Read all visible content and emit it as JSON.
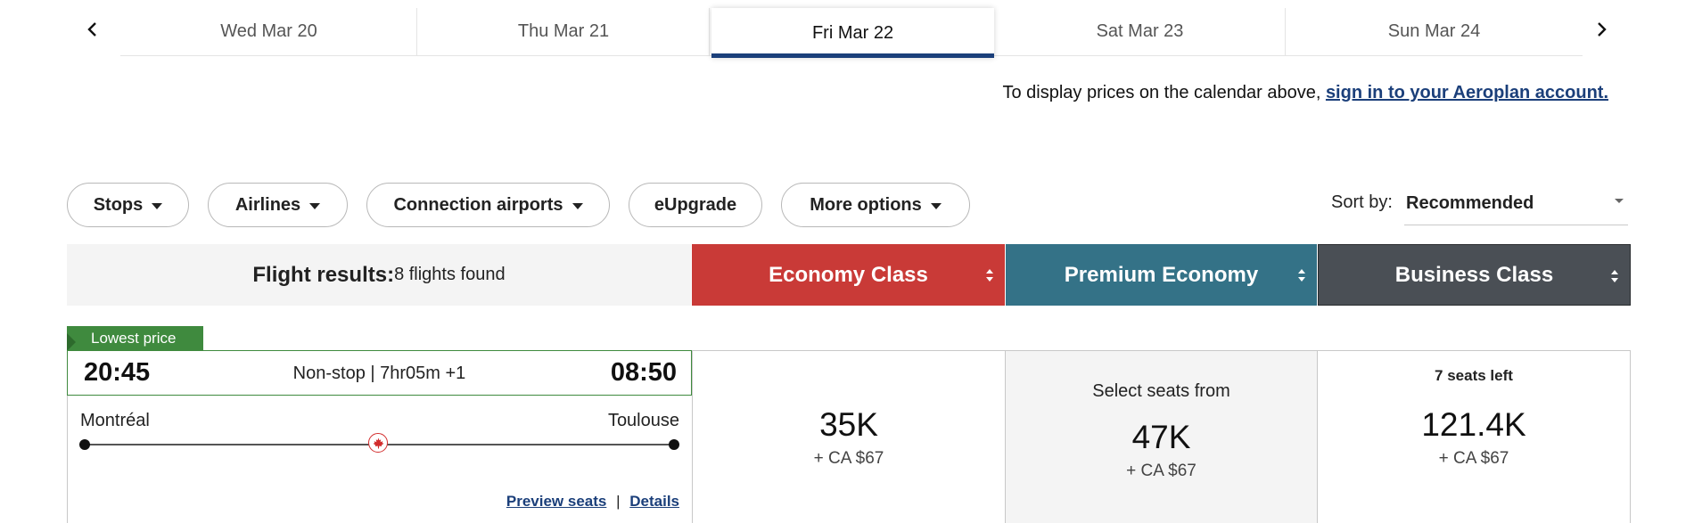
{
  "date_nav": {
    "prev_icon": "chevron-left-icon",
    "next_icon": "chevron-right-icon",
    "dates": [
      "Wed Mar 20",
      "Thu Mar 21",
      "Fri Mar 22",
      "Sat Mar 23",
      "Sun Mar 24"
    ],
    "selected_index": 2,
    "accent_color": "#1b3f7a"
  },
  "signin": {
    "prefix": "To display prices on the calendar above, ",
    "link": "sign in to your Aeroplan account."
  },
  "filters": {
    "stops": "Stops",
    "airlines": "Airlines",
    "connection_airports": "Connection airports",
    "eupgrade": "eUpgrade",
    "more_options": "More options"
  },
  "sort": {
    "label": "Sort by:",
    "value": "Recommended"
  },
  "results": {
    "label": "Flight results:",
    "count": "8 flights found"
  },
  "cabins": {
    "economy": {
      "label": "Economy Class",
      "color": "#c93a37"
    },
    "premium": {
      "label": "Premium Economy",
      "color": "#347287"
    },
    "business": {
      "label": "Business Class",
      "color": "#4a4f55"
    }
  },
  "flight": {
    "badge": "Lowest price",
    "badge_color": "#3f8a3e",
    "departure_time": "20:45",
    "arrival_time": "08:50",
    "duration": "Non-stop | 7hr05m +1",
    "origin": "Montréal",
    "destination": "Toulouse",
    "airline_icon": "air-canada-maple-leaf-icon",
    "preview_seats": "Preview seats",
    "separator": "|",
    "details": "Details",
    "economy": {
      "points": "35K",
      "fee": "+ CA $67"
    },
    "premium": {
      "note": "Select seats from",
      "points": "47K",
      "fee": "+ CA $67"
    },
    "business": {
      "note": "7 seats left",
      "points": "121.4K",
      "fee": "+ CA $67"
    }
  }
}
